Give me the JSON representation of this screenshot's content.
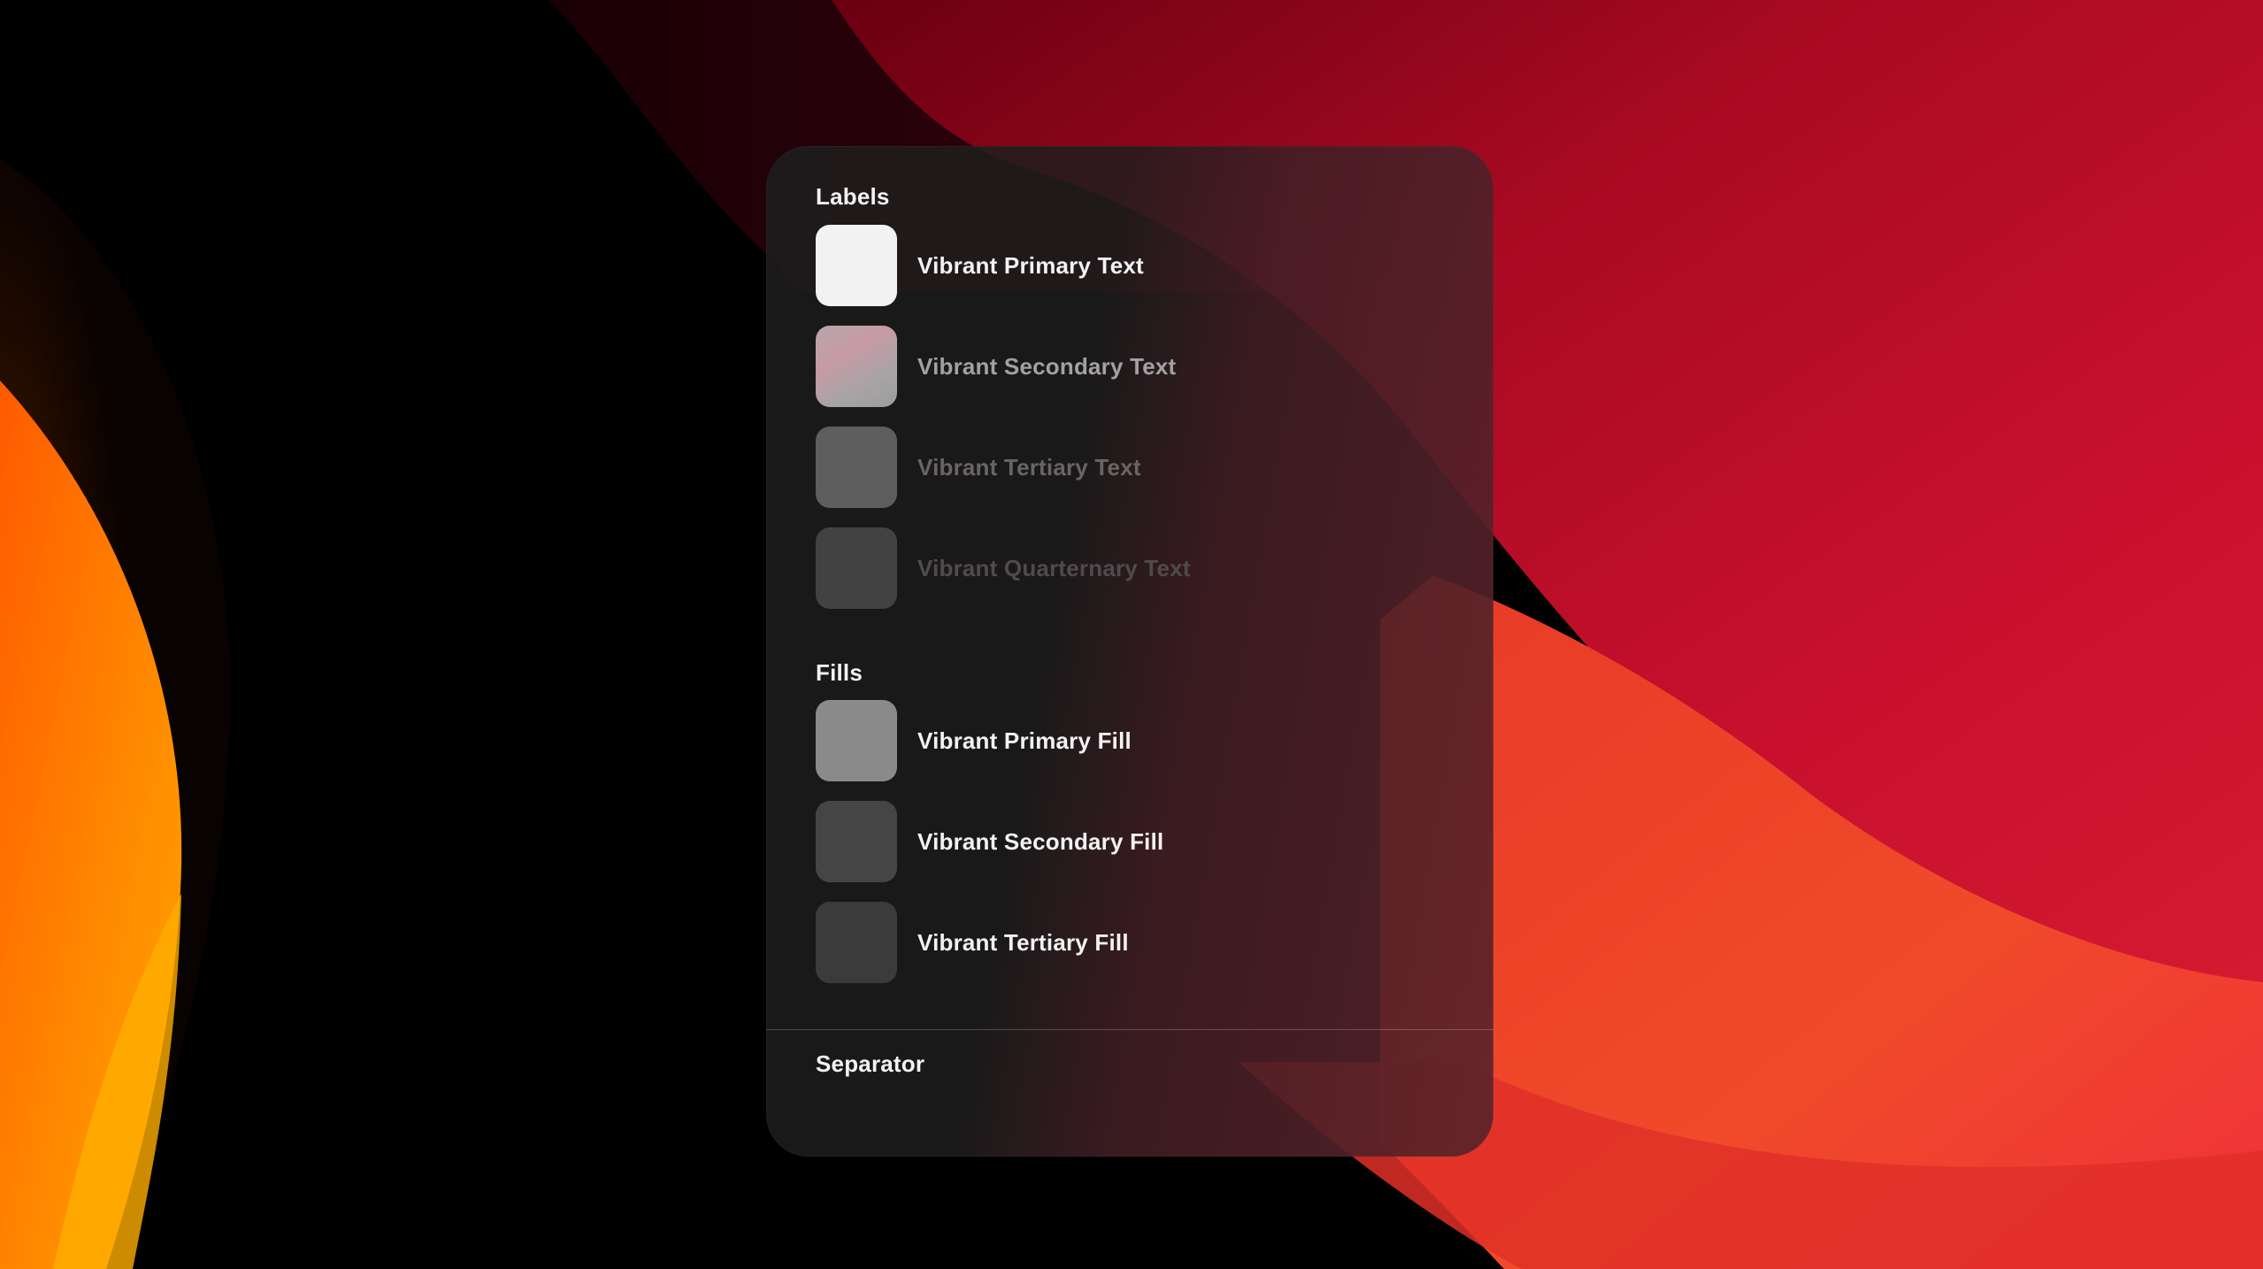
{
  "labels_section": {
    "title": "Labels",
    "items": [
      {
        "label": "Vibrant Primary Text",
        "swatch_color": "#f2f2f2",
        "text_color": "#f2f2f2"
      },
      {
        "label": "Vibrant Secondary Text",
        "swatch_color": "#a39fa1",
        "text_color": "#a4a0a2"
      },
      {
        "label": "Vibrant Tertiary Text",
        "swatch_color": "#5e5e5e",
        "text_color": "#6a6465"
      },
      {
        "label": "Vibrant Quarternary Text",
        "swatch_color": "#424242",
        "text_color": "#514a4c"
      }
    ]
  },
  "fills_section": {
    "title": "Fills",
    "items": [
      {
        "label": "Vibrant Primary Fill",
        "swatch_color": "#8a8a8a",
        "text_color": "#f2f2f2"
      },
      {
        "label": "Vibrant Secondary Fill",
        "swatch_color": "#454545",
        "text_color": "#f2f2f2"
      },
      {
        "label": "Vibrant Tertiary Fill",
        "swatch_color": "#3b3b3b",
        "text_color": "#f2f2f2"
      }
    ]
  },
  "separator_section": {
    "title": "Separator"
  },
  "colors": {
    "panel_bg": "#1e1e1e",
    "wallpaper_red": "#c8102e",
    "wallpaper_orange": "#ff8a00"
  }
}
